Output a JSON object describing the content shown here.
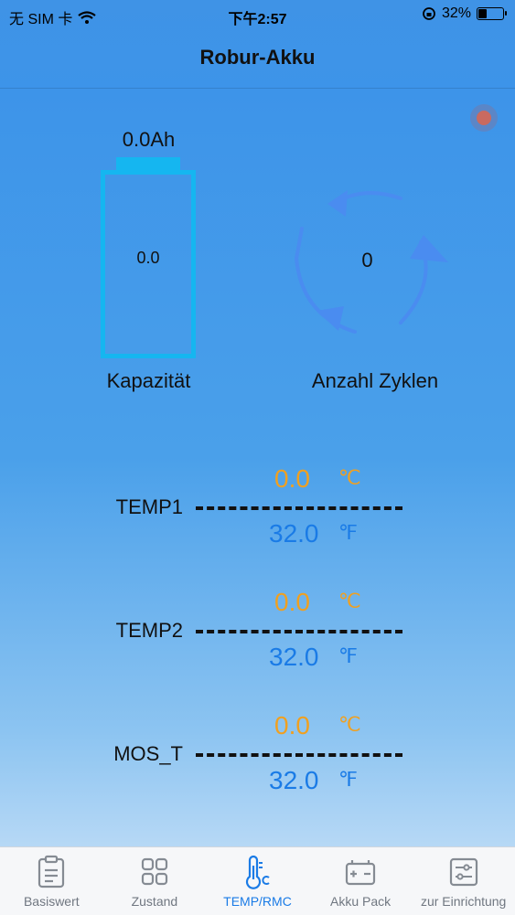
{
  "status": {
    "carrier": "无 SIM 卡",
    "time": "下午2:57",
    "battery": "32%",
    "battery_level": 0.32
  },
  "nav": {
    "title": "Robur-Akku"
  },
  "capacity": {
    "value": "0.0Ah",
    "inner": "0.0",
    "label": "Kapazität"
  },
  "cycles": {
    "count": "0",
    "label": "Anzahl Zyklen"
  },
  "temps": [
    {
      "name": "TEMP1",
      "celsius": "0.0",
      "c_unit": "℃",
      "fahrenheit": "32.0",
      "f_unit": "℉"
    },
    {
      "name": "TEMP2",
      "celsius": "0.0",
      "c_unit": "℃",
      "fahrenheit": "32.0",
      "f_unit": "℉"
    },
    {
      "name": "MOS_T",
      "celsius": "0.0",
      "c_unit": "℃",
      "fahrenheit": "32.0",
      "f_unit": "℉"
    }
  ],
  "tabs": [
    {
      "label": "Basiswert",
      "icon": "clipboard-icon"
    },
    {
      "label": "Zustand",
      "icon": "grid-icon"
    },
    {
      "label": "TEMP/RMC",
      "icon": "thermometer-icon"
    },
    {
      "label": "Akku Pack",
      "icon": "battery-pack-icon"
    },
    {
      "label": "zur Einrichtung",
      "icon": "settings-sliders-icon"
    }
  ],
  "colors": {
    "accent": "#1a7be6",
    "celsius": "#f0a020",
    "battery_outline": "#15b6f0",
    "cycle_arrows": "#4a8cf0"
  }
}
